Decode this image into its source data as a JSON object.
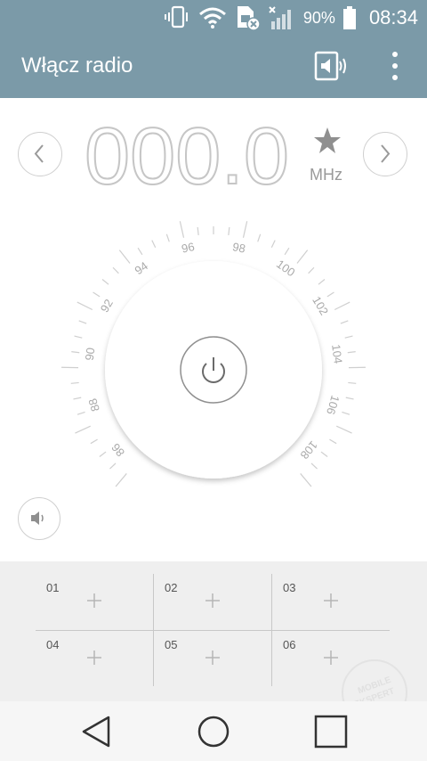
{
  "status_bar": {
    "battery_text": "90%",
    "time": "08:34",
    "icons": [
      "vibrate-icon",
      "wifi-icon",
      "sim-error-icon",
      "signal-icon",
      "battery-icon"
    ]
  },
  "app_bar": {
    "title": "Włącz radio",
    "icons": [
      "speaker-output-icon",
      "overflow-menu-icon"
    ]
  },
  "tuner": {
    "frequency_display": "000.0",
    "unit": "MHz",
    "icons": [
      "prev-chevron-icon",
      "next-chevron-icon",
      "favorite-star-icon"
    ]
  },
  "dial": {
    "scale_labels": [
      "86",
      "88",
      "90",
      "92",
      "94",
      "96",
      "98",
      "100",
      "102",
      "104",
      "106",
      "108"
    ],
    "icons": [
      "power-icon",
      "volume-icon"
    ]
  },
  "presets": [
    {
      "number": "01"
    },
    {
      "number": "02"
    },
    {
      "number": "03"
    },
    {
      "number": "04"
    },
    {
      "number": "05"
    },
    {
      "number": "06"
    }
  ],
  "watermark": {
    "line1": "MOBILE",
    "line2": "EKSPERT"
  },
  "colors": {
    "bar": "#7b9aa8",
    "digit": "#c6c6c6",
    "presets_bg": "#efefef"
  }
}
